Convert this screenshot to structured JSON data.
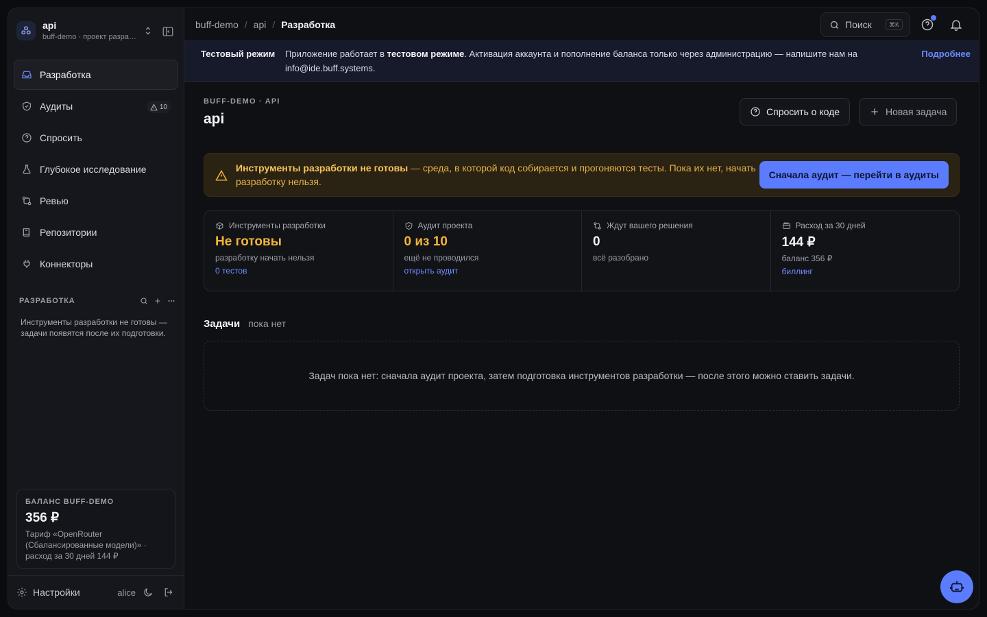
{
  "project": {
    "name": "api",
    "subtitle": "buff-demo · проект разработки"
  },
  "nav": [
    {
      "label": "Разработка",
      "icon": "inbox-icon",
      "active": true
    },
    {
      "label": "Аудиты",
      "icon": "shield-icon",
      "badge": "10"
    },
    {
      "label": "Спросить",
      "icon": "question-circle-icon"
    },
    {
      "label": "Глубокое исследование",
      "icon": "flask-icon"
    },
    {
      "label": "Ревью",
      "icon": "git-compare-icon"
    },
    {
      "label": "Репозитории",
      "icon": "repo-icon"
    },
    {
      "label": "Коннекторы",
      "icon": "plug-icon"
    }
  ],
  "section": {
    "title": "РАЗРАБОТКА",
    "note": "Инструменты разработки не готовы — задачи появятся после их подготовки."
  },
  "balance": {
    "title": "БАЛАНС BUFF-DEMO",
    "amount": "356 ₽",
    "note": "Тариф «OpenRouter (Сбалансированные модели)» · расход за 30 дней 144 ₽"
  },
  "footer": {
    "settings": "Настройки",
    "user": "alice"
  },
  "breadcrumb": [
    "buff-demo",
    "api",
    "Разработка"
  ],
  "search": {
    "label": "Поиск",
    "shortcut": "⌘K"
  },
  "test_banner": {
    "label": "Тестовый режим",
    "text_1": "Приложение работает в ",
    "text_bold": "тестовом режиме",
    "text_2": ". Активация аккаунта и пополнение баланса только через администрацию — напишите нам на info@ide.buff.systems.",
    "more": "Подробнее"
  },
  "page": {
    "eyebrow": "BUFF-DEMO · API",
    "title": "api",
    "ask_button": "Спросить о коде",
    "new_task_button": "Новая задача"
  },
  "warning": {
    "bold": "Инструменты разработки не готовы",
    "text": " — среда, в которой код собирается и прогоняются тесты. Пока их нет, начать разработку нельзя.",
    "button": "Сначала аудит — перейти в аудиты"
  },
  "stats": [
    {
      "label": "Инструменты разработки",
      "icon": "cube-icon",
      "value": "Не готовы",
      "sub": "разработку начать нельзя",
      "link": "0 тестов",
      "accent": "#f2b43a"
    },
    {
      "label": "Аудит проекта",
      "icon": "shield-check-icon",
      "value": "0 из 10",
      "sub": "ещё не проводился",
      "link": "открыть аудит",
      "accent": "#f2b43a"
    },
    {
      "label": "Ждут вашего решения",
      "icon": "git-compare-icon",
      "value": "0",
      "sub": "всё разобрано",
      "link": ""
    },
    {
      "label": "Расход за 30 дней",
      "icon": "wallet-icon",
      "value": "144 ₽",
      "sub": "баланс 356 ₽",
      "link": "биллинг"
    }
  ],
  "tasks": {
    "title": "Задачи",
    "count": "пока нет",
    "empty": "Задач пока нет: сначала аудит проекта, затем подготовка инструментов разработки — после этого можно ставить задачи."
  },
  "colors": {
    "accent": "#5b7cff",
    "warning": "#f2b43a"
  }
}
